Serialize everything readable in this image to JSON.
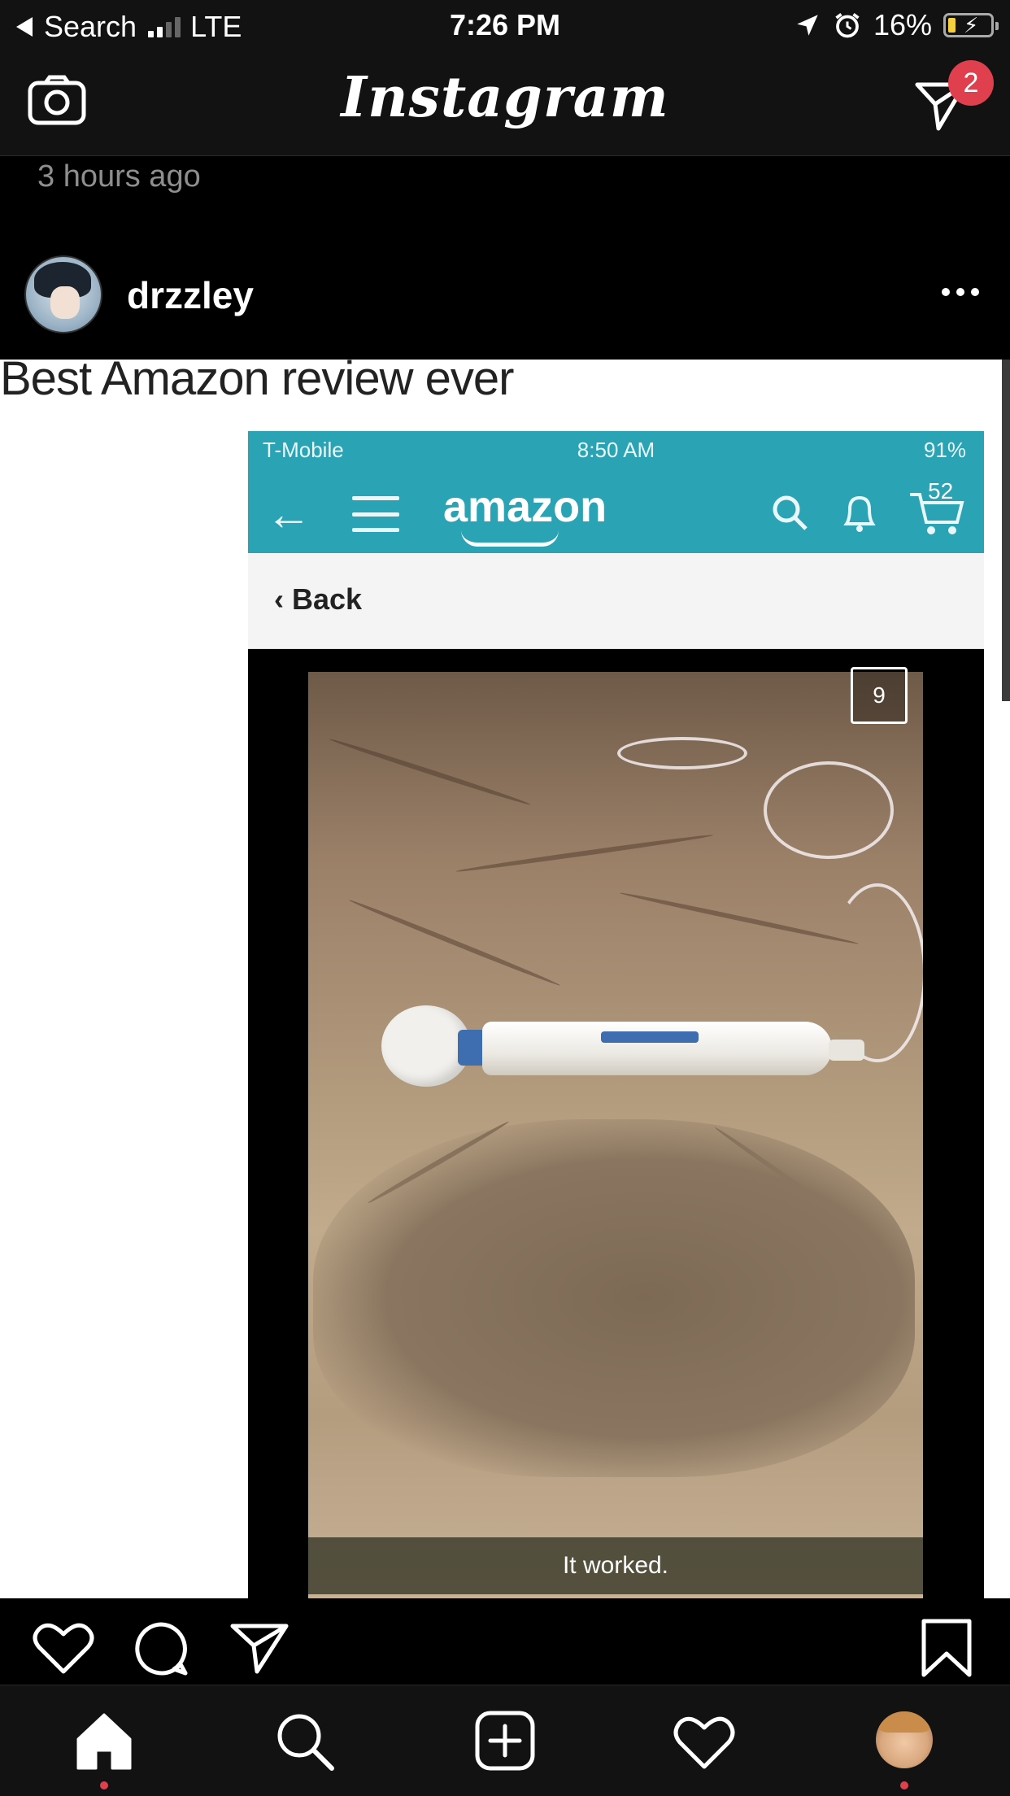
{
  "status_bar": {
    "back_label": "Search",
    "network": "LTE",
    "time": "7:26 PM",
    "battery_percent": "16%"
  },
  "header": {
    "app_title": "Instagram",
    "dm_badge_count": "2"
  },
  "feed": {
    "time_ago": "3 hours ago"
  },
  "post": {
    "username": "drzzley",
    "image_text": {
      "headline": "Best Amazon review ever",
      "phone_carrier": "T-Mobile",
      "phone_time": "8:50 AM",
      "phone_battery": "91%",
      "amazon_logo": "amazon",
      "cart_count": "52",
      "back_link": "Back",
      "photo_counter": "9",
      "photo_caption": "It worked."
    }
  },
  "icons": {
    "camera": "camera-icon",
    "direct": "paper-plane-icon",
    "more": "more-horizontal-icon",
    "like": "heart-icon",
    "comment": "comment-icon",
    "share": "paper-plane-icon",
    "save": "bookmark-icon",
    "home": "home-icon",
    "search": "search-icon",
    "new_post": "plus-square-icon",
    "activity": "heart-icon"
  },
  "colors": {
    "background": "#000000",
    "bar": "#121212",
    "badge": "#e0404e",
    "amazon_teal": "#2aa3b5"
  }
}
